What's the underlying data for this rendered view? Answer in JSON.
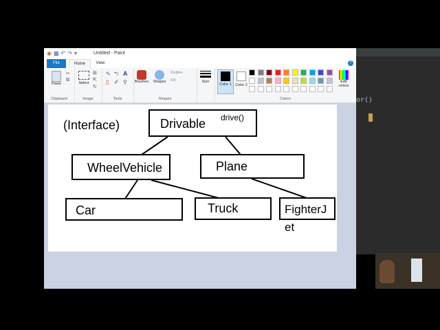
{
  "window": {
    "title": "Untitled - Paint"
  },
  "tabs": [
    {
      "label": "File"
    },
    {
      "label": "Home"
    },
    {
      "label": "View"
    }
  ],
  "ribbon": {
    "paste_label": "Paste",
    "select_label": "Select",
    "brushes_label": "Brushes",
    "shapes_label": "Shapes",
    "outline_label": "Outline",
    "fill_label": "Fill",
    "size_label": "Size",
    "color1_label": "Color 1",
    "color2_label": "Color 2",
    "edit_colors_label": "Edit colors",
    "groups": {
      "clipboard": "Clipboard",
      "image": "Image",
      "tools": "Tools",
      "shapes": "Shapes",
      "colors": "Colors"
    },
    "palette": [
      "#000000",
      "#7f7f7f",
      "#880015",
      "#ed1c24",
      "#ff7f27",
      "#fff200",
      "#22b14c",
      "#00a2e8",
      "#3f48cc",
      "#a349a4",
      "#ffffff",
      "#c3c3c3",
      "#b97a57",
      "#ffaec9",
      "#ffc90e",
      "#efe4b0",
      "#b5e61d",
      "#99d9ea",
      "#7092be",
      "#c8bfe7"
    ]
  },
  "drawing": {
    "interface_note": "(Interface)",
    "drivable": "Drivable",
    "drive_method": "drive()",
    "wheel_vehicle": "WheelVehicle",
    "plane": "Plane",
    "car": "Car",
    "truck": "Truck",
    "fighter_line1": "FighterJ",
    "fighter_line2": "et"
  },
  "editor": {
    "code_fragment": "or()"
  }
}
